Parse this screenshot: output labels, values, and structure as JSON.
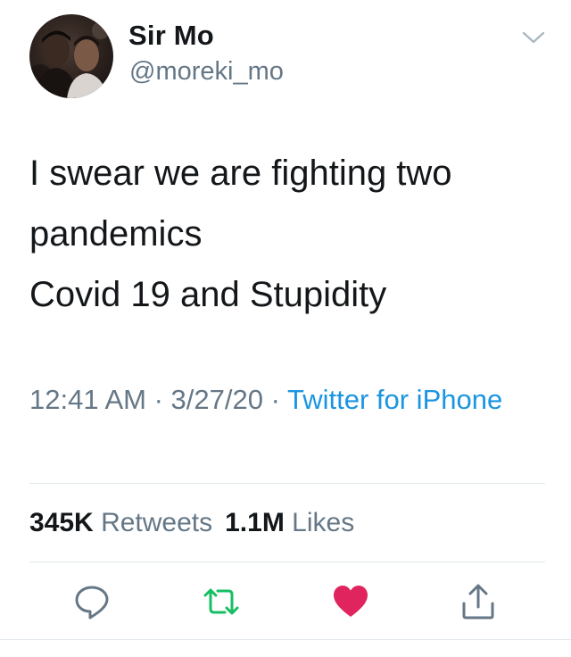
{
  "user": {
    "display_name": "Sir Mo",
    "handle": "@moreki_mo",
    "avatar_icon": "profile-photo"
  },
  "tweet": {
    "lines": [
      "I swear we are fighting two",
      "pandemics",
      "Covid 19 and Stupidity"
    ],
    "time": "12:41 AM",
    "separator": " · ",
    "date": "3/27/20",
    "source": "Twitter for iPhone"
  },
  "stats": {
    "retweets_count": "345K",
    "retweets_label": "Retweets",
    "likes_count": "1.1M",
    "likes_label": "Likes"
  },
  "actions": {
    "reply_icon": "reply-icon",
    "retweet_icon": "retweet-icon",
    "like_icon": "heart-icon",
    "share_icon": "share-icon"
  },
  "colors": {
    "text": "#14171a",
    "secondary": "#657786",
    "link": "#1b95e0",
    "retweet_green": "#17bf63",
    "like_red": "#e0245e",
    "divider": "#e1e8ed"
  }
}
